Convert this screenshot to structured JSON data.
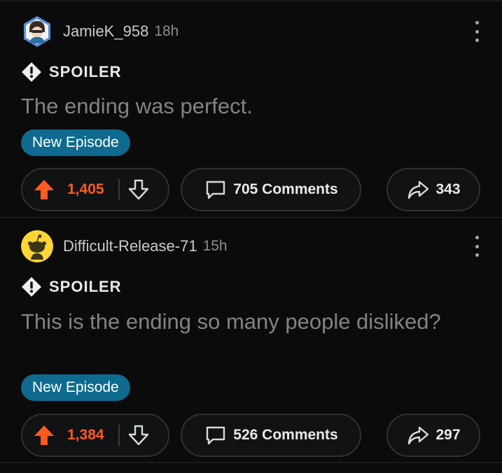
{
  "posts": [
    {
      "username": "JamieK_958",
      "age": "18h",
      "spoiler_label": "SPOILER",
      "title": "The ending was perfect.",
      "flair": "New Episode",
      "score": "1,405",
      "comments_label": "705 Comments",
      "share_count": "343",
      "avatar_icon": "custom-avatar-icon"
    },
    {
      "username": "Difficult-Release-71",
      "age": "15h",
      "spoiler_label": "SPOILER",
      "title": "This is the ending so many people disliked?",
      "flair": "New Episode",
      "score": "1,384",
      "comments_label": "526 Comments",
      "share_count": "297",
      "avatar_icon": "default-snoo-avatar-icon"
    }
  ],
  "colors": {
    "background": "#0b0b0b",
    "upvote_accent": "#ff5a1f",
    "flair_bg": "#0e6a8e",
    "title_text": "#818384"
  }
}
